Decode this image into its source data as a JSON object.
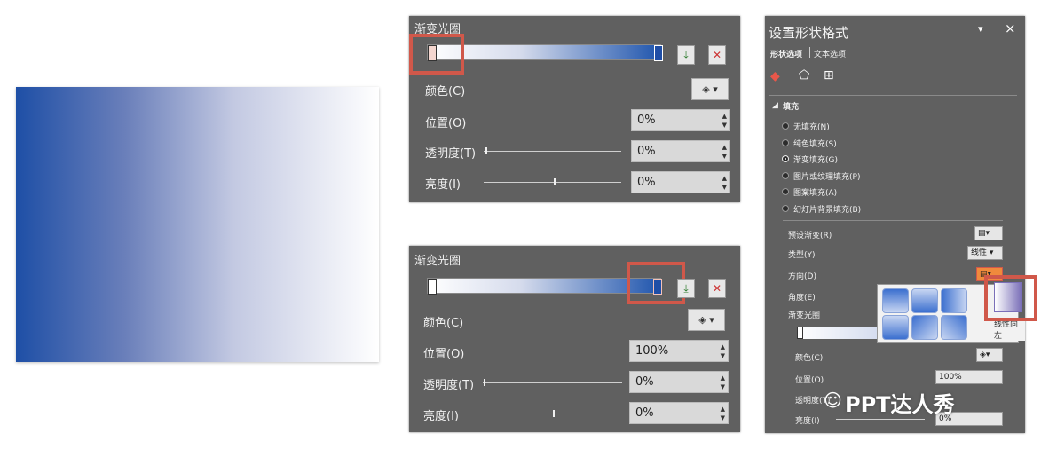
{
  "panel1": {
    "title": "渐变光圈",
    "color_label": "颜色(C)",
    "position_label": "位置(O)",
    "position_value": "0%",
    "transparency_label": "透明度(T)",
    "transparency_value": "0%",
    "brightness_label": "亮度(I)",
    "brightness_value": "0%",
    "stop_colors": [
      "#ffffff",
      "#1f4ea6"
    ]
  },
  "panel2": {
    "title": "渐变光圈",
    "color_label": "颜色(C)",
    "position_label": "位置(O)",
    "position_value": "100%",
    "transparency_label": "透明度(T)",
    "transparency_value": "0%",
    "brightness_label": "亮度(I)",
    "brightness_value": "0%"
  },
  "format_pane": {
    "title": "设置形状格式",
    "tabs": [
      "形状选项",
      "文本选项"
    ],
    "section": "填充",
    "fill_options": [
      {
        "label": "无填充(N)",
        "selected": false
      },
      {
        "label": "纯色填充(S)",
        "selected": false
      },
      {
        "label": "渐变填充(G)",
        "selected": true
      },
      {
        "label": "图片或纹理填充(P)",
        "selected": false
      },
      {
        "label": "图案填充(A)",
        "selected": false
      },
      {
        "label": "幻灯片背景填充(B)",
        "selected": false
      }
    ],
    "preset_label": "预设渐变(R)",
    "type_label": "类型(Y)",
    "type_value": "线性",
    "direction_label": "方向(D)",
    "angle_label": "角度(E)",
    "stops_label": "渐变光圈",
    "color_label": "颜色(C)",
    "position_label": "位置(O)",
    "position_value": "100%",
    "transparency_label": "透明度(T)",
    "brightness_label": "亮度(I)",
    "brightness_value": "0%",
    "tooltip": "线性向左",
    "close_glyph": "×",
    "menu_glyph": "▾"
  },
  "watermark": "PPT达人秀",
  "colors": {
    "accent_highlight": "#d0584a",
    "panel_bg": "#606060",
    "gradient_start": "#1e4fa6",
    "gradient_end": "#ffffff"
  }
}
